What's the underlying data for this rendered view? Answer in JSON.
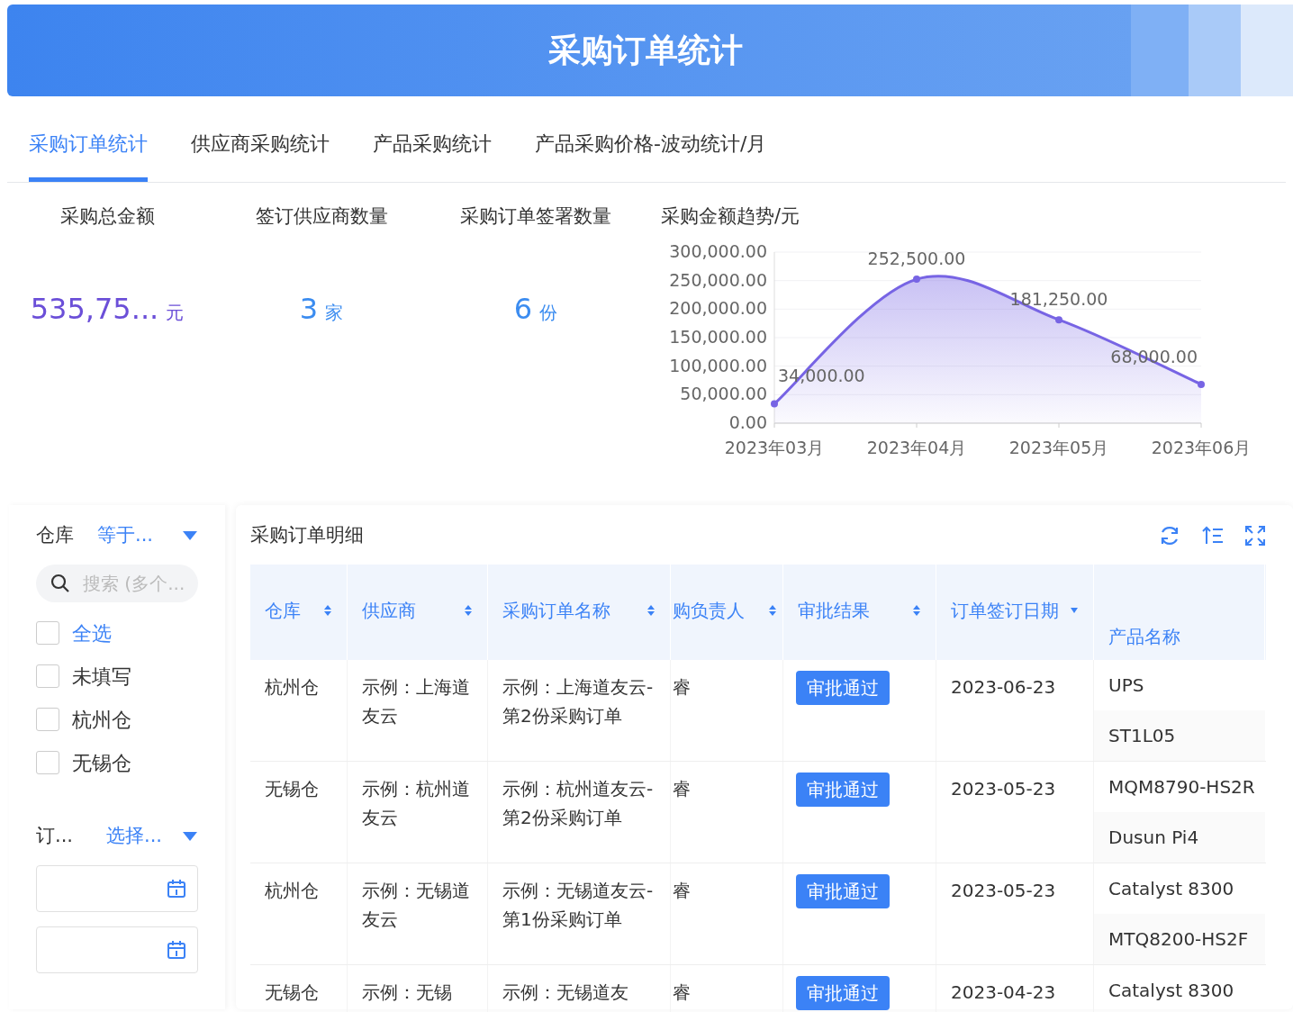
{
  "header": {
    "title": "采购订单统计"
  },
  "tabs": [
    {
      "label": "采购订单统计",
      "selected": true
    },
    {
      "label": "供应商采购统计",
      "selected": false
    },
    {
      "label": "产品采购统计",
      "selected": false
    },
    {
      "label": "产品采购价格-波动统计/月",
      "selected": false
    }
  ],
  "stats": [
    {
      "label": "采购总金额",
      "value": "535,75...",
      "unit": "元",
      "color": "#6b4fd8"
    },
    {
      "label": "签订供应商数量",
      "value": "3",
      "unit": "家",
      "color": "#3b8cf0"
    },
    {
      "label": "采购订单签署数量",
      "value": "6",
      "unit": "份",
      "color": "#3b8cf0"
    }
  ],
  "trend": {
    "title": "采购金额趋势/元",
    "chart_data": {
      "type": "area",
      "categories": [
        "2023年03月",
        "2023年04月",
        "2023年05月",
        "2023年06月"
      ],
      "series": [
        {
          "color": "#7764e4",
          "values": [
            34000,
            252500,
            181250,
            68000
          ]
        }
      ],
      "ylim": [
        0,
        300000
      ],
      "grid": true,
      "yticks": [
        {
          "value": 0,
          "label": "0.00"
        },
        {
          "value": 50000,
          "label": "50,000.00"
        },
        {
          "value": 100000,
          "label": "100,000.00"
        },
        {
          "value": 150000,
          "label": "150,000.00"
        },
        {
          "value": 200000,
          "label": "200,000.00"
        },
        {
          "value": 250000,
          "label": "250,000.00"
        },
        {
          "value": 300000,
          "label": "300,000.00"
        }
      ],
      "value_labels": [
        "34,000.00",
        "252,500.00",
        "181,250.00",
        "68,000.00"
      ]
    }
  },
  "filters": {
    "warehouse": {
      "label": "仓库",
      "operator": "等于...",
      "search_placeholder": "搜索 (多个...",
      "options": [
        {
          "label": "全选",
          "kind": "all",
          "checked": false
        },
        {
          "label": "未填写",
          "kind": "option",
          "checked": false
        },
        {
          "label": "杭州仓",
          "kind": "option",
          "checked": false
        },
        {
          "label": "无锡仓",
          "kind": "option",
          "checked": false
        }
      ]
    },
    "date": {
      "label": "订...",
      "operator": "选择...",
      "fields": [
        {
          "kind": "date"
        },
        {
          "kind": "date"
        }
      ]
    }
  },
  "table": {
    "title": "采购订单明细",
    "columns": [
      {
        "label": "仓库",
        "sortable": true,
        "sorted_descending": false
      },
      {
        "label": "供应商",
        "sortable": true,
        "sorted_descending": false
      },
      {
        "label": "采购订单名称",
        "sortable": true,
        "sorted_descending": false
      },
      {
        "label": "购负责人",
        "sortable": true,
        "sorted_descending": false
      },
      {
        "label": "审批结果",
        "sortable": true,
        "sorted_descending": false
      },
      {
        "label": "订单签订日期",
        "sortable": true,
        "sorted_descending": true
      },
      {
        "label": "产品名称",
        "sortable": false,
        "sorted_descending": false
      }
    ],
    "rows": [
      {
        "warehouse": "杭州仓",
        "supplier": "示例：上海道友云",
        "order": "示例：上海道友云-第2份采购订单",
        "owner": "睿",
        "status": "审批通过",
        "date": "2023-06-23",
        "products": [
          "UPS",
          "ST1L05"
        ]
      },
      {
        "warehouse": "无锡仓",
        "supplier": "示例：杭州道友云",
        "order": "示例：杭州道友云-第2份采购订单",
        "owner": "睿",
        "status": "审批通过",
        "date": "2023-05-23",
        "products": [
          "MQM8790-HS2R",
          "Dusun Pi4"
        ]
      },
      {
        "warehouse": "杭州仓",
        "supplier": "示例：无锡道友云",
        "order": "示例：无锡道友云-第1份采购订单",
        "owner": "睿",
        "status": "审批通过",
        "date": "2023-05-23",
        "products": [
          "Catalyst 8300",
          "MTQ8200-HS2F"
        ]
      },
      {
        "warehouse": "无锡仓",
        "supplier": "示例：无锡",
        "order": "示例：无锡道友",
        "owner": "睿",
        "status": "审批通过",
        "date": "2023-04-23",
        "products": [
          "Catalyst 8300"
        ]
      }
    ]
  }
}
